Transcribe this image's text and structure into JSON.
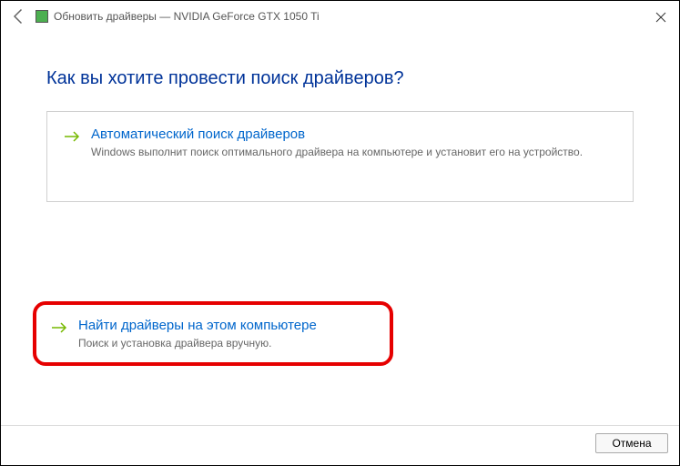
{
  "window": {
    "title": "Обновить драйверы — NVIDIA GeForce GTX 1050 Ti"
  },
  "heading": "Как вы хотите провести поиск драйверов?",
  "options": {
    "auto": {
      "title": "Автоматический поиск драйверов",
      "desc": "Windows выполнит поиск оптимального драйвера на компьютере и установит его на устройство."
    },
    "manual": {
      "title": "Найти драйверы на этом компьютере",
      "desc": "Поиск и установка драйвера вручную."
    }
  },
  "buttons": {
    "cancel": "Отмена"
  }
}
